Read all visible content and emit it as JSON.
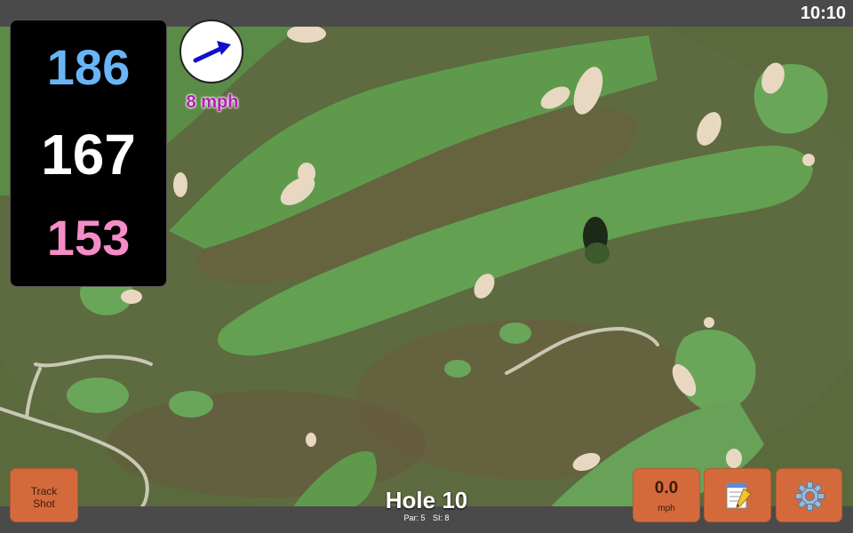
{
  "clock": "10:10",
  "distances": {
    "back": "186",
    "middle": "167",
    "front": "153"
  },
  "wind": {
    "speed_label": "8 mph",
    "direction_icon": "arrow-icon"
  },
  "hole": {
    "title": "Hole 10",
    "par": "Par: 5",
    "stroke_index": "SI: 8"
  },
  "buttons": {
    "track_shot": [
      "Track",
      "Shot"
    ],
    "wind_speed_value": "0.0",
    "wind_speed_unit": "mph",
    "notes_icon": "notepad-icon",
    "settings_icon": "gear-icon"
  },
  "colors": {
    "back": "#6ab4f5",
    "middle": "#ffffff",
    "front": "#f58cc8",
    "wind_arrow": "#1010cc",
    "wind_text": "#b020b0",
    "button_bg": "#d46a3c",
    "panel_bg": "#000000"
  }
}
